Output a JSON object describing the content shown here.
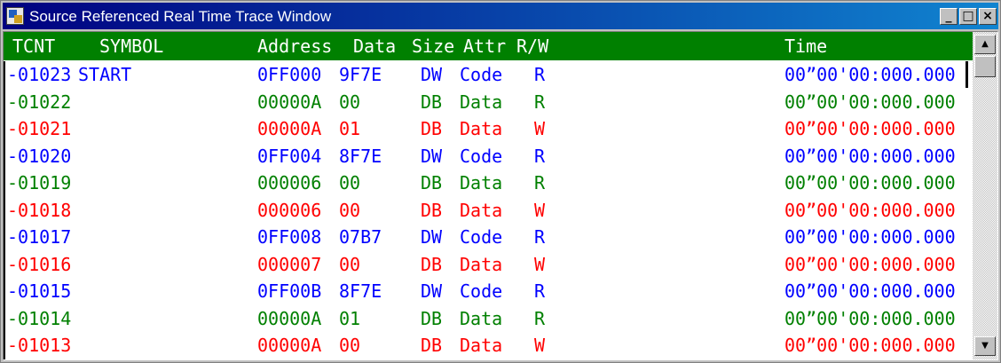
{
  "window": {
    "title": "Source Referenced Real Time Trace Window"
  },
  "titlebar_buttons": {
    "minimize": "_",
    "maximize": "□",
    "close": "×"
  },
  "columns": {
    "tcnt": "TCNT",
    "symbol": "SYMBOL",
    "address": "Address",
    "data": "Data",
    "size": "Size",
    "attr": "Attr",
    "rw": "R/W",
    "time": "Time"
  },
  "colors": {
    "header_bg": "#008000",
    "blue": "#0000ff",
    "green": "#008000",
    "red": "#ff0000"
  },
  "rows": [
    {
      "tcnt": "-01023",
      "symbol": "START",
      "address": "0FF000",
      "data": "9F7E",
      "size": "DW",
      "attr": "Code",
      "rw": "R",
      "time": "00”00'00:000.000",
      "color": "blue"
    },
    {
      "tcnt": "-01022",
      "symbol": "",
      "address": "00000A",
      "data": "00",
      "size": "DB",
      "attr": "Data",
      "rw": "R",
      "time": "00”00'00:000.000",
      "color": "green"
    },
    {
      "tcnt": "-01021",
      "symbol": "",
      "address": "00000A",
      "data": "01",
      "size": "DB",
      "attr": "Data",
      "rw": "W",
      "time": "00”00'00:000.000",
      "color": "red"
    },
    {
      "tcnt": "-01020",
      "symbol": "",
      "address": "0FF004",
      "data": "8F7E",
      "size": "DW",
      "attr": "Code",
      "rw": "R",
      "time": "00”00'00:000.000",
      "color": "blue"
    },
    {
      "tcnt": "-01019",
      "symbol": "",
      "address": "000006",
      "data": "00",
      "size": "DB",
      "attr": "Data",
      "rw": "R",
      "time": "00”00'00:000.000",
      "color": "green"
    },
    {
      "tcnt": "-01018",
      "symbol": "",
      "address": "000006",
      "data": "00",
      "size": "DB",
      "attr": "Data",
      "rw": "W",
      "time": "00”00'00:000.000",
      "color": "red"
    },
    {
      "tcnt": "-01017",
      "symbol": "",
      "address": "0FF008",
      "data": "07B7",
      "size": "DW",
      "attr": "Code",
      "rw": "R",
      "time": "00”00'00:000.000",
      "color": "blue"
    },
    {
      "tcnt": "-01016",
      "symbol": "",
      "address": "000007",
      "data": "00",
      "size": "DB",
      "attr": "Data",
      "rw": "W",
      "time": "00”00'00:000.000",
      "color": "red"
    },
    {
      "tcnt": "-01015",
      "symbol": "",
      "address": "0FF00B",
      "data": "8F7E",
      "size": "DW",
      "attr": "Code",
      "rw": "R",
      "time": "00”00'00:000.000",
      "color": "blue"
    },
    {
      "tcnt": "-01014",
      "symbol": "",
      "address": "00000A",
      "data": "01",
      "size": "DB",
      "attr": "Data",
      "rw": "R",
      "time": "00”00'00:000.000",
      "color": "green"
    },
    {
      "tcnt": "-01013",
      "symbol": "",
      "address": "00000A",
      "data": "00",
      "size": "DB",
      "attr": "Data",
      "rw": "W",
      "time": "00”00'00:000.000",
      "color": "red"
    }
  ],
  "scrollbar": {
    "up_icon": "triangle-up-icon",
    "down_icon": "triangle-down-icon"
  }
}
